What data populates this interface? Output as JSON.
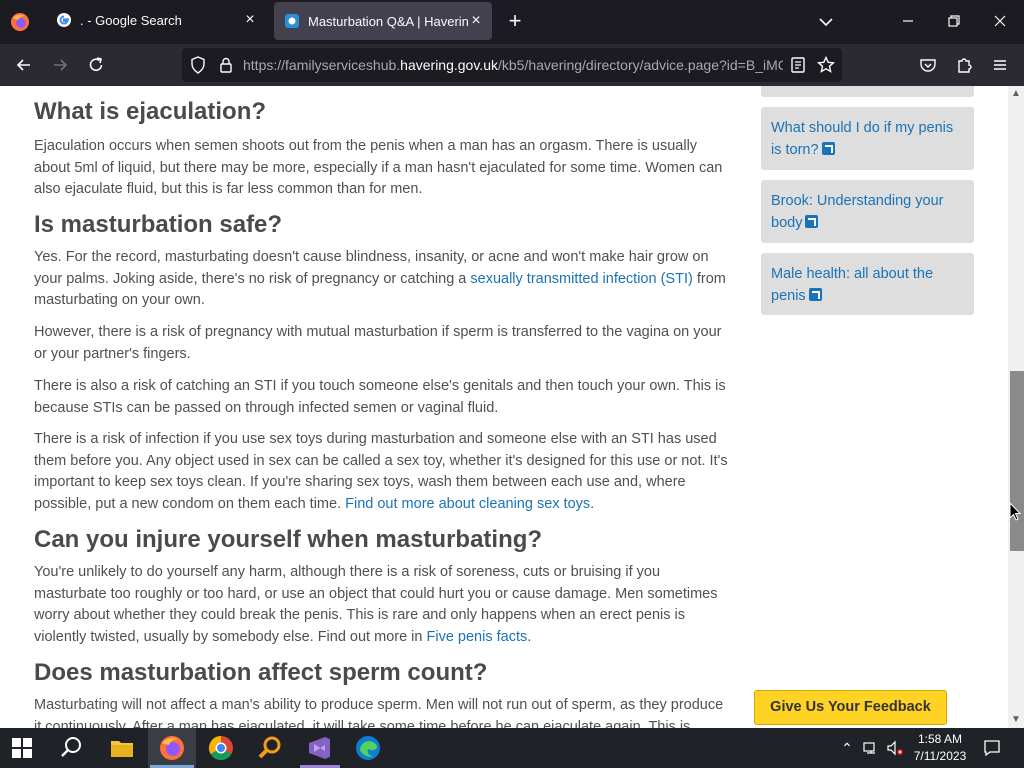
{
  "browser": {
    "tabs": [
      {
        "title": ". - Google Search",
        "active": false
      },
      {
        "title": "Masturbation Q&A | Havering F",
        "active": true
      }
    ],
    "new_tab": "+",
    "url_prefix": "https://familyserviceshub.",
    "url_host": "havering.gov.uk",
    "url_suffix": "/kb5/havering/directory/advice.page?id=B_iMC"
  },
  "article": {
    "sections": [
      {
        "heading": "What is ejaculation?"
      },
      {
        "heading": "Is masturbation safe?"
      },
      {
        "heading": "Can you injure yourself when masturbating?"
      },
      {
        "heading": "Does masturbation affect sperm count?"
      }
    ],
    "p1": "Ejaculation occurs when semen shoots out from the penis when a man has an orgasm. There is usually about 5ml of liquid, but there may be more, especially if a man hasn't ejaculated for some time. Women can also ejaculate fluid, but this is far less common than for men.",
    "p2_before": "Yes. For the record, masturbating doesn't cause blindness, insanity, or acne and won't make hair grow on your palms. Joking aside, there's no risk of pregnancy or catching a ",
    "p2_link": "sexually transmitted infection (STI)",
    "p2_after": " from masturbating on your own.",
    "p3": "However, there is a risk of pregnancy with mutual masturbation if sperm is transferred to the vagina on your or your partner's fingers.",
    "p4": "There is also a risk of catching an STI if you touch someone else's genitals and then touch your own. This is because STIs can be passed on through infected semen or vaginal fluid.",
    "p5_before": "There is a risk of infection if you use sex toys during masturbation and someone else with an STI has used them before you. Any object used in sex can be called a sex toy, whether it's designed for this use or not. It's important to keep sex toys clean. If you're sharing sex toys, wash them between each use and, where possible, put a new condom on them each time. ",
    "p5_link": "Find out more about cleaning sex toys",
    "p5_after": ".",
    "p6_before": "You're unlikely to do yourself any harm, although there is a risk of soreness, cuts or bruising if you masturbate too roughly or too hard, or use an object that could hurt you or cause damage. Men sometimes worry about whether they could break the penis. This is rare and only happens when an erect penis is violently twisted, usually by somebody else. Find out more in ",
    "p6_link": "Five penis facts",
    "p6_after": ".",
    "p7": "Masturbating will not affect a man's ability to produce sperm. Men will not run out of sperm, as they produce it continuously. After a man has ejaculated, it will take some time before he can ejaculate again. This is"
  },
  "sidebar": {
    "links": [
      {
        "label": "What should I do if my penis is torn?"
      },
      {
        "label": "Brook: Understanding your body"
      },
      {
        "label": "Male health: all about the penis"
      }
    ]
  },
  "feedback_label": "Give Us Your Feedback",
  "taskbar": {
    "time": "1:58 AM",
    "date": "7/11/2023"
  }
}
